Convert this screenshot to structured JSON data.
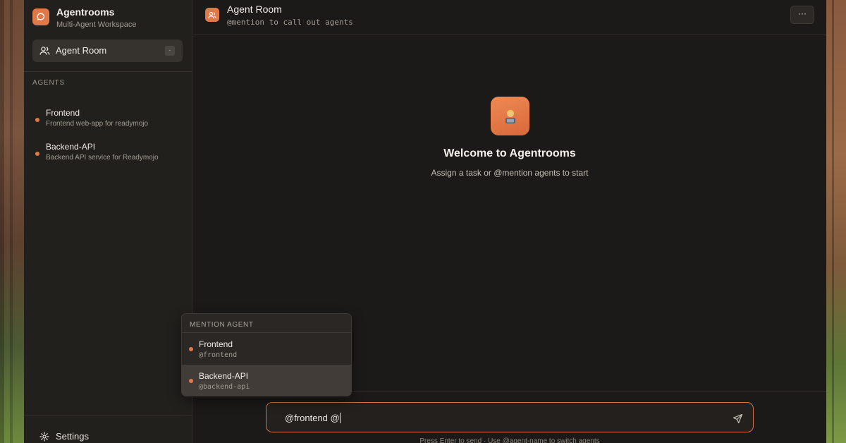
{
  "sidebar": {
    "brand_title": "Agentrooms",
    "brand_subtitle": "Multi-Agent Workspace",
    "room": {
      "label": "Agent Room",
      "badge": "·"
    },
    "section_label": "AGENTS",
    "agents": [
      {
        "name": "Frontend",
        "description": "Frontend web-app for readymojo"
      },
      {
        "name": "Backend-API",
        "description": "Backend API service for Readymojo"
      }
    ],
    "settings_label": "Settings"
  },
  "header": {
    "title": "Agent Room",
    "subtitle": "@mention to call out agents",
    "menu_label": "···"
  },
  "welcome": {
    "emoji": "🧑‍💻",
    "title": "Welcome to Agentrooms",
    "subtitle": "Assign a task or @mention agents to start"
  },
  "mention_popup": {
    "heading": "MENTION AGENT",
    "options": [
      {
        "name": "Frontend",
        "handle": "@frontend",
        "highlighted": false
      },
      {
        "name": "Backend-API",
        "handle": "@backend-api",
        "highlighted": true
      }
    ]
  },
  "composer": {
    "value": "@frontend @",
    "hint": "Press Enter to send · Use @agent-name to switch agents"
  },
  "colors": {
    "accent": "#e0794a",
    "background": "#1c1a18",
    "sidebar": "#22201d"
  }
}
